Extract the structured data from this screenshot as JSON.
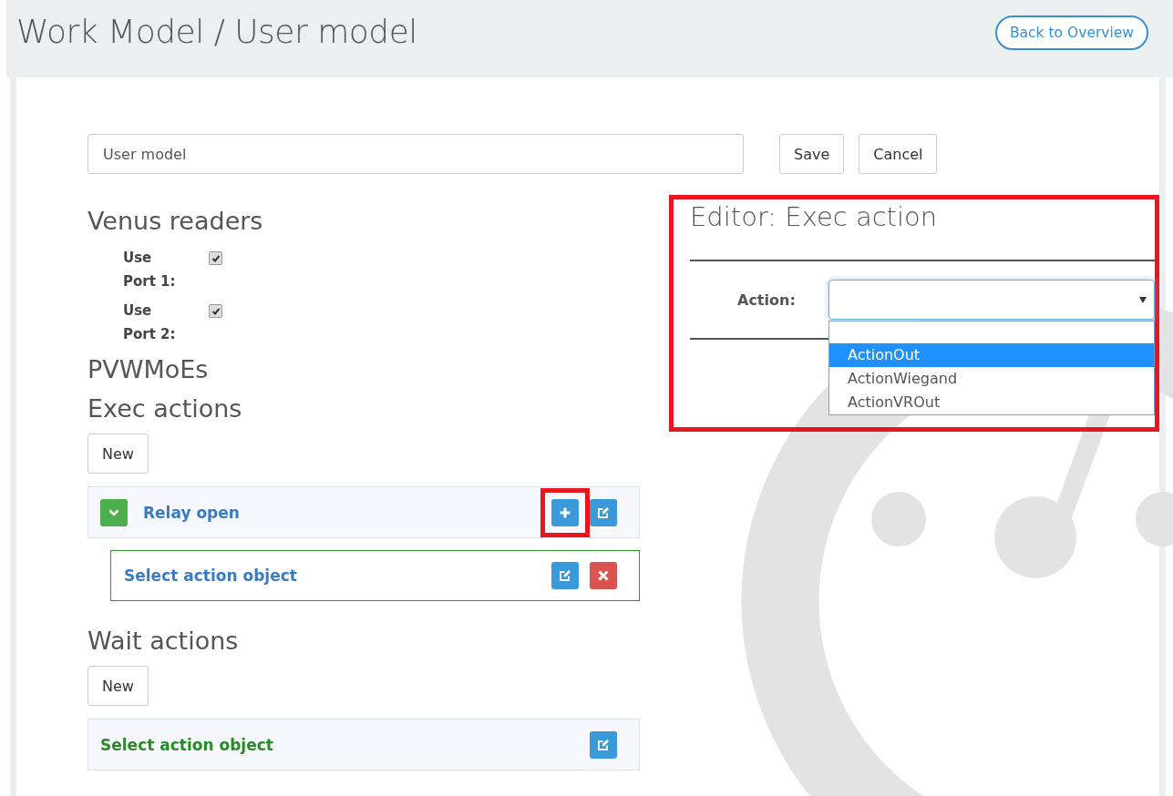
{
  "page": {
    "title": "Work Model / User model",
    "back_button": "Back to Overview"
  },
  "name_field": {
    "value": "User model"
  },
  "form_buttons": [
    "Save",
    "Cancel"
  ],
  "venus_readers": {
    "heading": "Venus readers",
    "ports": [
      {
        "label": "Use Port 1:",
        "checked": true
      },
      {
        "label": "Use Port 2:",
        "checked": true
      }
    ]
  },
  "pvwmoes": {
    "heading": "PVWMoEs"
  },
  "exec_actions": {
    "heading": "Exec actions",
    "new_button": "New",
    "items": [
      {
        "label": "Relay open",
        "expanded": true,
        "add_highlighted": true,
        "children": [
          {
            "label": "Select action object"
          }
        ]
      }
    ]
  },
  "wait_actions": {
    "heading": "Wait actions",
    "new_button": "New",
    "items": [
      {
        "label": "Select action object"
      }
    ]
  },
  "editor": {
    "title": "Editor: Exec action",
    "highlighted": true,
    "field_label": "Action:",
    "select": {
      "expanded": true,
      "options": [
        {
          "label": "ActionOut",
          "selected": true
        },
        {
          "label": "ActionWiegand",
          "selected": false
        },
        {
          "label": "ActionVROut",
          "selected": false
        }
      ]
    }
  }
}
